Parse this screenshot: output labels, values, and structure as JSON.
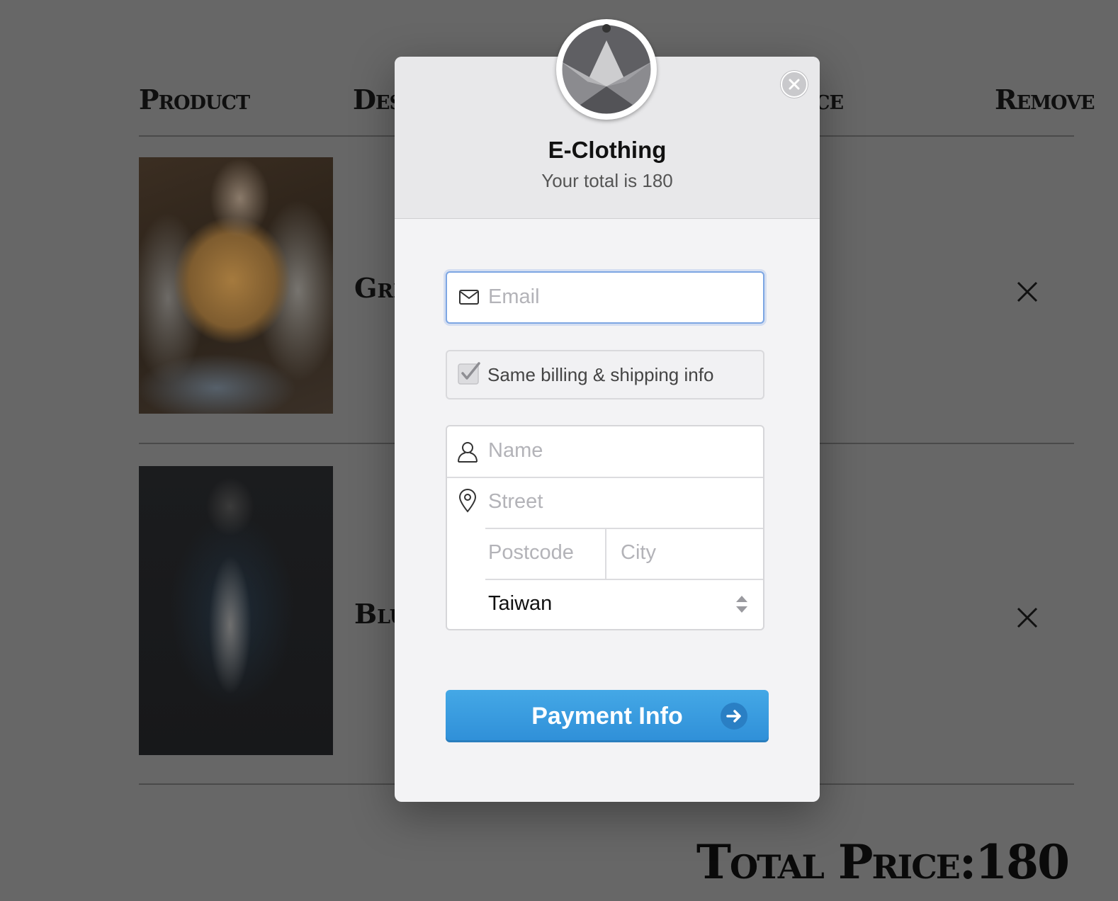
{
  "cart": {
    "headers": {
      "product": "Product",
      "description_partial": "Des",
      "price_partial": "ce",
      "remove": "Remove"
    },
    "items": [
      {
        "name_partial": "Gre",
        "photo": "woman-denim-jacket-photo"
      },
      {
        "name_partial": "Blu",
        "photo": "man-denim-jacket-photo"
      }
    ],
    "total_label": "Total Price:180"
  },
  "modal": {
    "title": "E-Clothing",
    "subtitle": "Your total is 180",
    "email": {
      "placeholder": "Email",
      "icon": "mail-icon"
    },
    "same_info": {
      "label": "Same billing & shipping info",
      "checked": true
    },
    "name": {
      "placeholder": "Name",
      "icon": "user-icon"
    },
    "street": {
      "placeholder": "Street",
      "icon": "location-pin-icon"
    },
    "postcode": {
      "placeholder": "Postcode"
    },
    "city": {
      "placeholder": "City"
    },
    "country": {
      "value": "Taiwan"
    },
    "pay_button": {
      "label": "Payment Info",
      "icon": "arrow-right-icon",
      "color": "#3a9de0"
    }
  }
}
